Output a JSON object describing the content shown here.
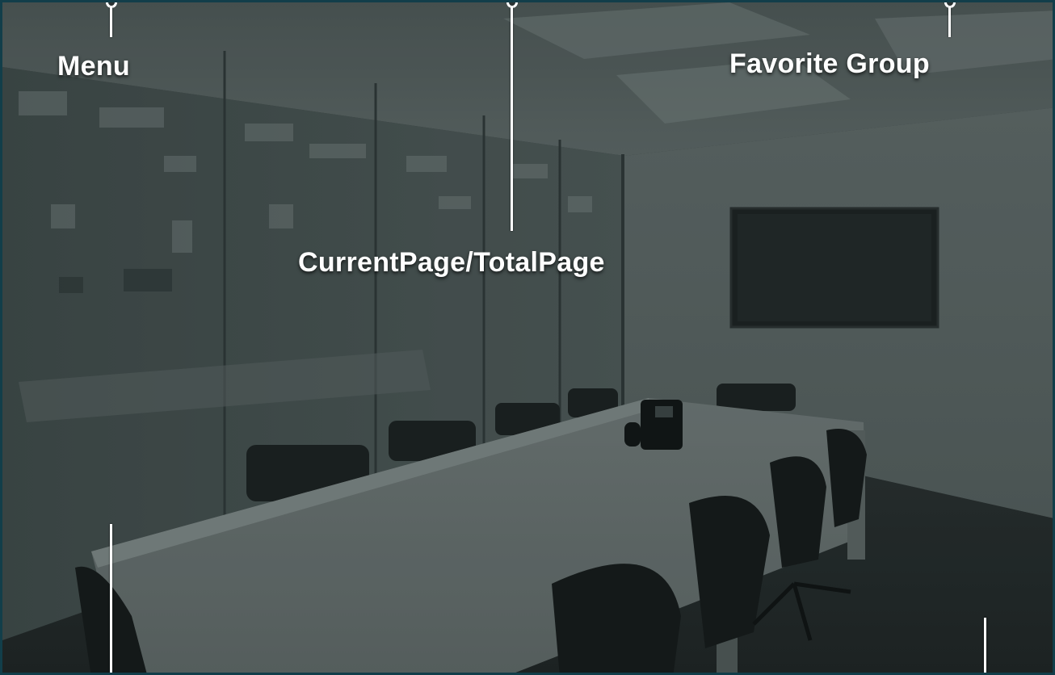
{
  "callouts": {
    "menu": {
      "label": "Menu"
    },
    "page_indicator": {
      "label": "CurrentPage/TotalPage"
    },
    "favorite_group": {
      "label": "Favorite Group"
    }
  },
  "background": {
    "description_icon": "conference-room-photo"
  },
  "colors": {
    "frame_border": "#123e4a",
    "label_text": "#ffffff"
  }
}
